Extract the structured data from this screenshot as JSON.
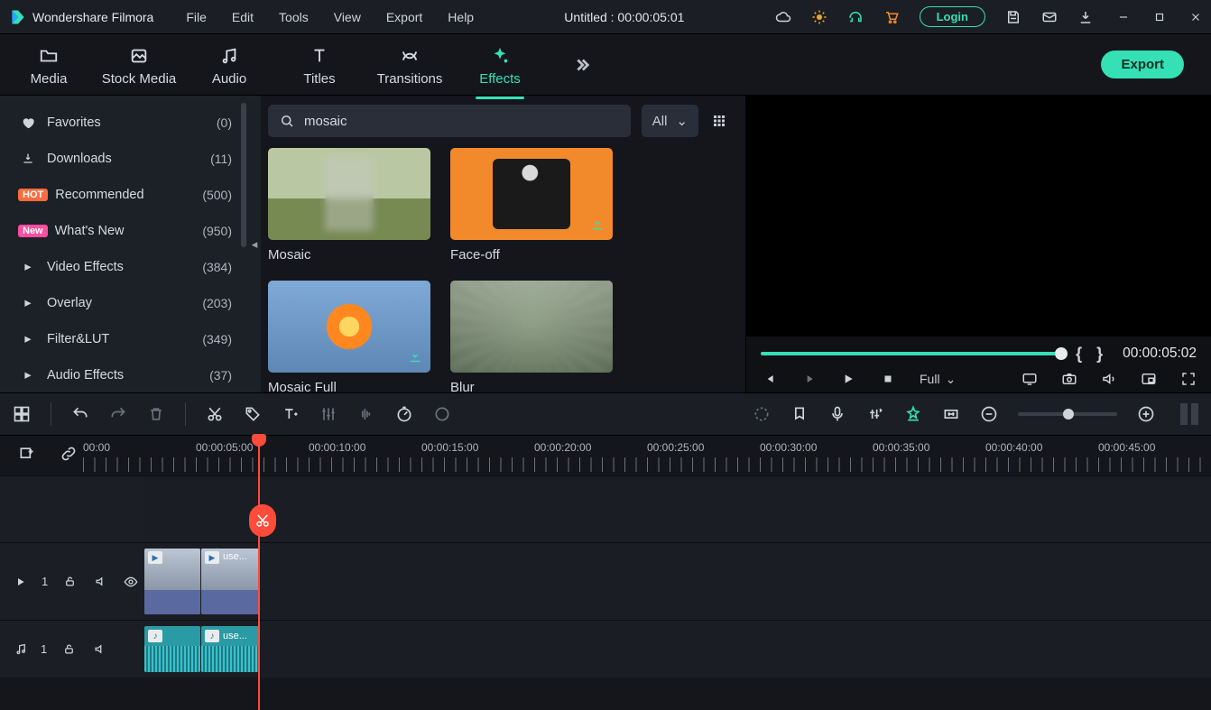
{
  "app": {
    "name": "Wondershare Filmora"
  },
  "menu": {
    "file": "File",
    "edit": "Edit",
    "tools": "Tools",
    "view": "View",
    "export": "Export",
    "help": "Help"
  },
  "title": "Untitled : 00:00:05:01",
  "login": "Login",
  "tabs": {
    "media": "Media",
    "stock": "Stock Media",
    "audio": "Audio",
    "titles": "Titles",
    "transitions": "Transitions",
    "effects": "Effects"
  },
  "export_btn": "Export",
  "sidebar": {
    "items": [
      {
        "label": "Favorites",
        "count": "(0)"
      },
      {
        "label": "Downloads",
        "count": "(11)"
      },
      {
        "label": "Recommended",
        "count": "(500)",
        "badge": "HOT"
      },
      {
        "label": "What's New",
        "count": "(950)",
        "badge": "New"
      },
      {
        "label": "Video Effects",
        "count": "(384)"
      },
      {
        "label": "Overlay",
        "count": "(203)"
      },
      {
        "label": "Filter&LUT",
        "count": "(349)"
      },
      {
        "label": "Audio Effects",
        "count": "(37)"
      }
    ]
  },
  "search": {
    "value": "mosaic"
  },
  "filter_dd": "All",
  "cards": [
    {
      "label": "Mosaic"
    },
    {
      "label": "Face-off"
    },
    {
      "label": "Mosaic Full"
    },
    {
      "label": "Blur"
    }
  ],
  "preview": {
    "time": "00:00:05:02",
    "quality": "Full"
  },
  "ruler": [
    "00:00",
    "00:00:05:00",
    "00:00:10:00",
    "00:00:15:00",
    "00:00:20:00",
    "00:00:25:00",
    "00:00:30:00",
    "00:00:35:00",
    "00:00:40:00",
    "00:00:45:00"
  ],
  "tracks": {
    "video": {
      "index": "1",
      "clip2_name": "use..."
    },
    "audio": {
      "index": "1",
      "clip2_name": "use..."
    }
  }
}
